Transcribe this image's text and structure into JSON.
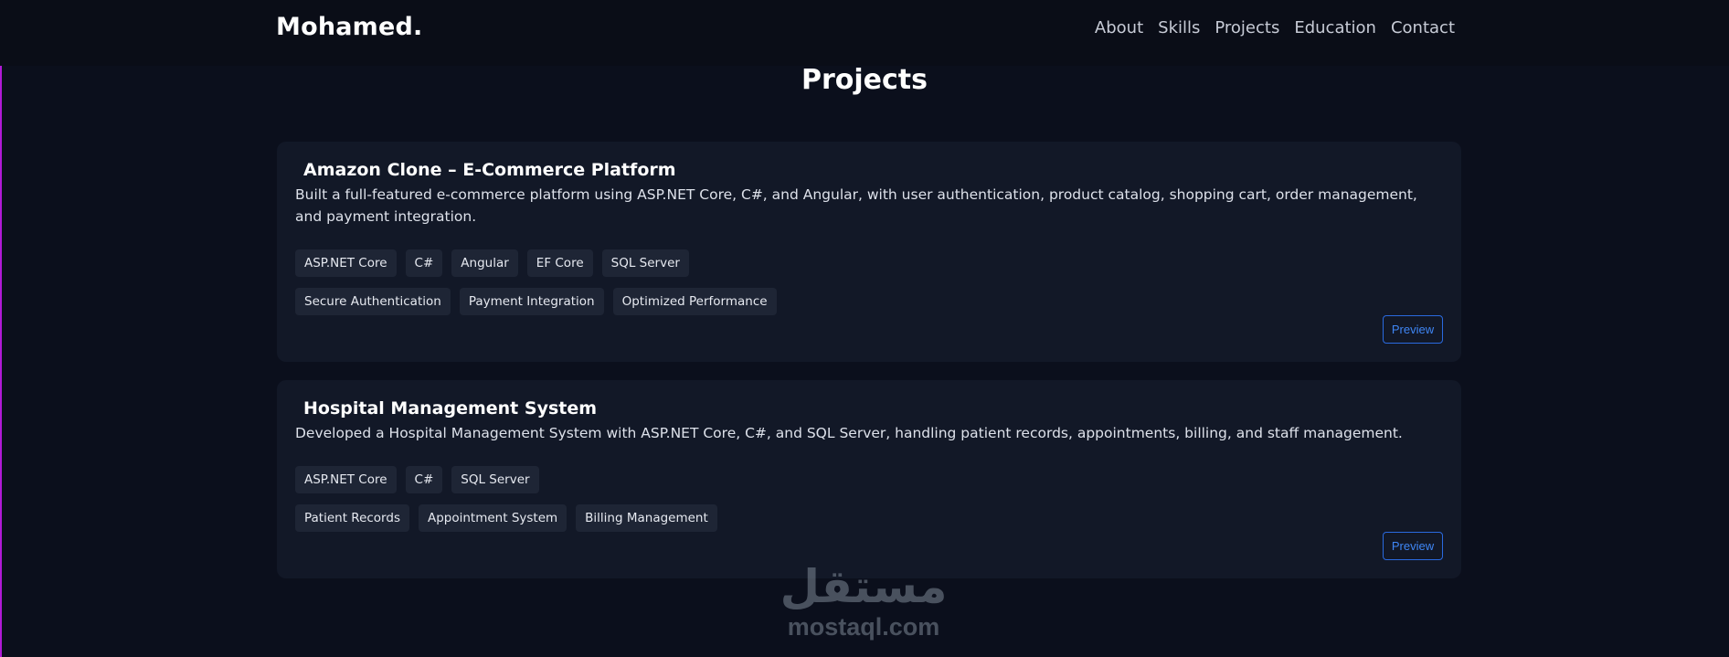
{
  "nav": {
    "brand": "Mohamed.",
    "links": [
      "About",
      "Skills",
      "Projects",
      "Education",
      "Contact"
    ]
  },
  "section": {
    "title": "Projects"
  },
  "projects": [
    {
      "title": "Amazon Clone – E-Commerce Platform",
      "description": "Built a full-featured e-commerce platform using ASP.NET Core, C#, and Angular, with user authentication, product catalog, shopping cart, order management, and payment integration.",
      "tech": [
        "ASP.NET Core",
        "C#",
        "Angular",
        "EF Core",
        "SQL Server"
      ],
      "features": [
        "Secure Authentication",
        "Payment Integration",
        "Optimized Performance"
      ],
      "preview_label": "Preview"
    },
    {
      "title": "Hospital Management System",
      "description": "Developed a Hospital Management System with ASP.NET Core, C#, and SQL Server, handling patient records, appointments, billing, and staff management.",
      "tech": [
        "ASP.NET Core",
        "C#",
        "SQL Server"
      ],
      "features": [
        "Patient Records",
        "Appointment System",
        "Billing Management"
      ],
      "preview_label": "Preview"
    }
  ],
  "watermark": {
    "arabic": "مستقل",
    "latin": "mostaql.com"
  },
  "colors": {
    "background": "#0b0f1c",
    "card": "#121827",
    "tag": "#1e2535",
    "accent_blue": "#3f86f5",
    "left_accent": "#b01ad6"
  }
}
